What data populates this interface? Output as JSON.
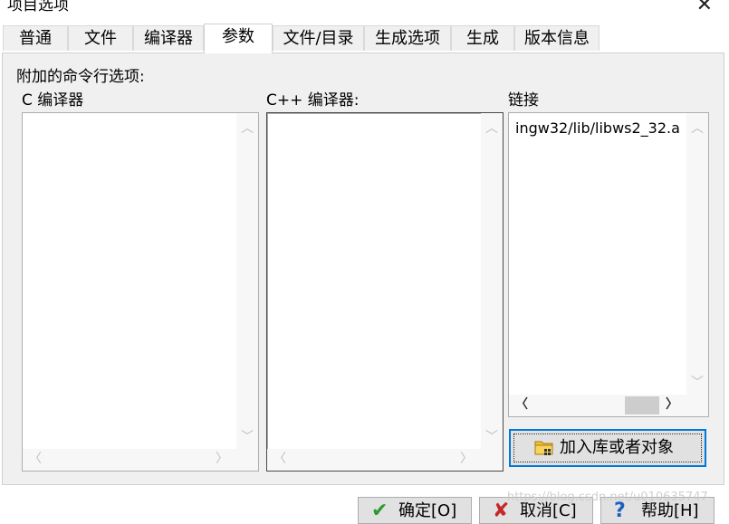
{
  "window": {
    "title": "项目选项"
  },
  "tabs": [
    {
      "label": "普通"
    },
    {
      "label": "文件"
    },
    {
      "label": "编译器"
    },
    {
      "label": "参数",
      "active": true
    },
    {
      "label": "文件/目录"
    },
    {
      "label": "生成选项"
    },
    {
      "label": "生成"
    },
    {
      "label": "版本信息"
    }
  ],
  "params": {
    "header": "附加的命令行选项:",
    "c_compiler_label": "C 编译器",
    "cpp_compiler_label": "C++ 编译器:",
    "linker_label": "链接",
    "c_compiler_text": "",
    "cpp_compiler_text": "",
    "linker_text": "ingw32/lib/libws2_32.a",
    "add_library_button": "加入库或者对象"
  },
  "buttons": {
    "ok": "确定[O]",
    "cancel": "取消[C]",
    "help": "帮助[H]"
  },
  "icons": {
    "ok": "checkmark-icon",
    "cancel": "x-icon",
    "help": "question-icon",
    "add": "folder-icon"
  },
  "colors": {
    "focus_border": "#0078d7",
    "ok_green": "#2e9a2e",
    "cancel_red": "#c62828",
    "help_blue": "#1f5fbf"
  },
  "watermark": "https://blog.csdn.net/u010635747"
}
